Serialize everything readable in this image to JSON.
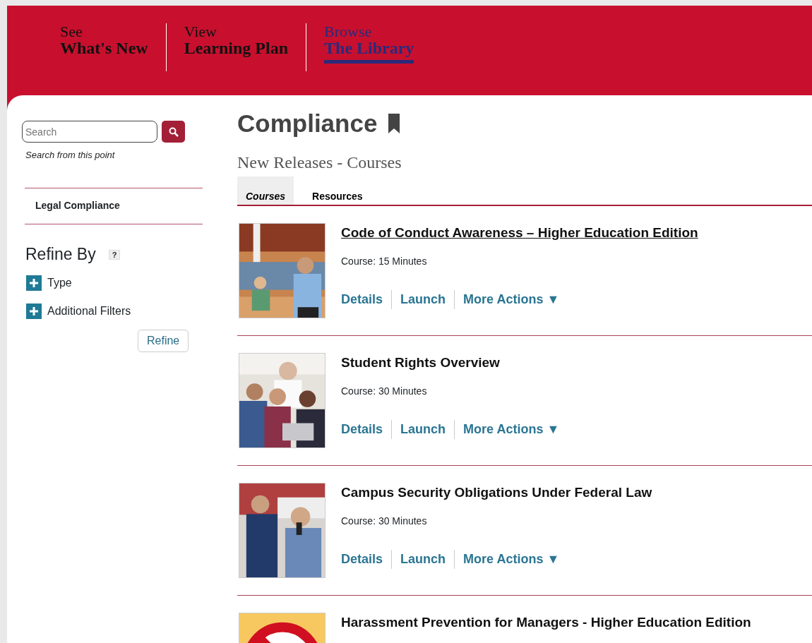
{
  "nav": [
    {
      "line1": "See",
      "line2": "What's New",
      "selected": false
    },
    {
      "line1": "View",
      "line2": "Learning Plan",
      "selected": false
    },
    {
      "line1": "Browse",
      "line2": "The Library",
      "selected": true
    }
  ],
  "sidebar": {
    "search": {
      "placeholder": "Search"
    },
    "search_hint": "Search from this point",
    "category": "Legal Compliance",
    "refine_title": "Refine By",
    "help": "?",
    "filters": [
      {
        "label": "Type"
      },
      {
        "label": "Additional Filters"
      }
    ],
    "refine_button": "Refine"
  },
  "page_title": "Compliance",
  "section_title": "New Releases - Courses",
  "tabs": [
    {
      "label": "Courses",
      "selected": true
    },
    {
      "label": "Resources",
      "selected": false
    }
  ],
  "courses": [
    {
      "title": "Code of Conduct Awareness – Higher Education Edition",
      "underlined": true,
      "meta": "Course: 15 Minutes",
      "actions": [
        "Details",
        "Launch",
        "More Actions ▼"
      ],
      "kind": "picture"
    },
    {
      "title": "Student Rights Overview",
      "underlined": false,
      "meta": "Course: 30 Minutes",
      "actions": [
        "Details",
        "Launch",
        "More Actions ▼"
      ],
      "kind": "picture"
    },
    {
      "title": "Campus Security Obligations Under Federal Law",
      "underlined": false,
      "meta": "Course: 30 Minutes",
      "actions": [
        "Details",
        "Launch",
        "More Actions ▼"
      ],
      "kind": "picture"
    },
    {
      "title": "Harassment Prevention for Managers - Higher Education Edition",
      "underlined": false,
      "kind": "picture"
    }
  ]
}
